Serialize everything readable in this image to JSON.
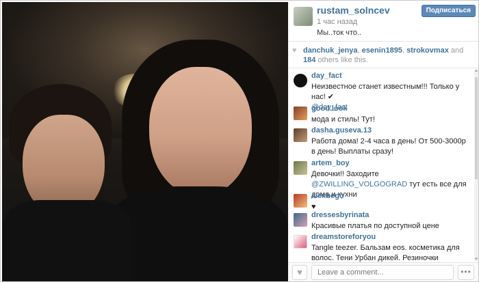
{
  "post": {
    "owner": "rustam_solncev",
    "time": "1 час назад",
    "caption": "Мы..ток что..",
    "follow_label": "Подписаться"
  },
  "likes": {
    "users": [
      "danchuk_jenya",
      "esenin1895",
      "strokovmax"
    ],
    "connector": "and",
    "count": "184",
    "suffix": "others like this."
  },
  "comments": [
    {
      "user": "day_fact",
      "text": "Неизвестное станет известным!!!  Только у нас! ✔",
      "mention": "@day_fact",
      "prefix": ""
    },
    {
      "user": "good.look",
      "text": "мода и стиль! Тут!"
    },
    {
      "user": "dasha.guseva.13",
      "text": "Работа дома! 2-4 часа в день! От 500-3000р в день! Выплаты сразу!"
    },
    {
      "user": "artem_boy",
      "text_before": "Девочки!! Заходите  ",
      "mention": "@ZWILLING_VOLGOGRAD",
      "text_after": " тут есть все для дома и кухни"
    },
    {
      "user": "alexbego",
      "text": "♥"
    },
    {
      "user": "dressesbyrinata",
      "text": "Красивые платья по доступной цене"
    },
    {
      "user": "dreamstoreforyou",
      "text": "Tangle teezer. Бальзам eos. косметика для волос. Тени Урбан дикей. Резиночки invisibobble и многое"
    }
  ],
  "footer": {
    "like_icon": "♥",
    "placeholder": "Leave a comment...",
    "more_label": "•••"
  },
  "colors": {
    "link": "#3f729b",
    "button": "#5c89b8"
  }
}
